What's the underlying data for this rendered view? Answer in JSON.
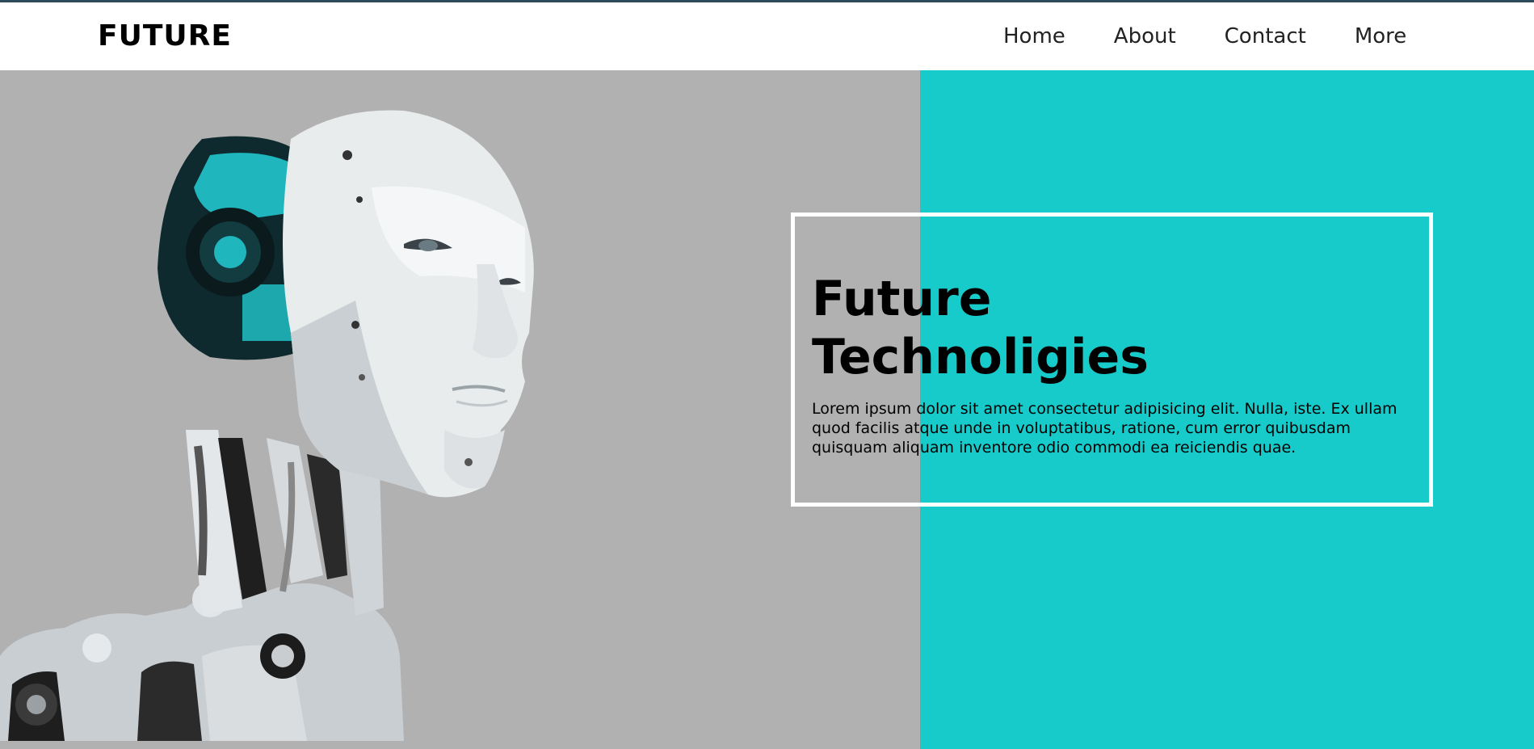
{
  "brand": {
    "logo": "FUTURE"
  },
  "nav": {
    "items": [
      {
        "label": "Home"
      },
      {
        "label": "About"
      },
      {
        "label": "Contact"
      },
      {
        "label": "More"
      }
    ]
  },
  "hero": {
    "title_line1": "Future",
    "title_line2": "Technoligies",
    "text": "Lorem ipsum dolor sit amet consectetur adipisicing elit. Nulla, iste. Ex ullam quod facilis atque unde in voluptatibus, ratione, cum error quibusdam quisquam aliquam inventore odio commodi ea reiciendis quae.",
    "image": "robot-head-image"
  },
  "colors": {
    "accent": "#18cbcb",
    "hero_left_bg": "#b1b1b1",
    "topbar": "#2c4a5a"
  }
}
